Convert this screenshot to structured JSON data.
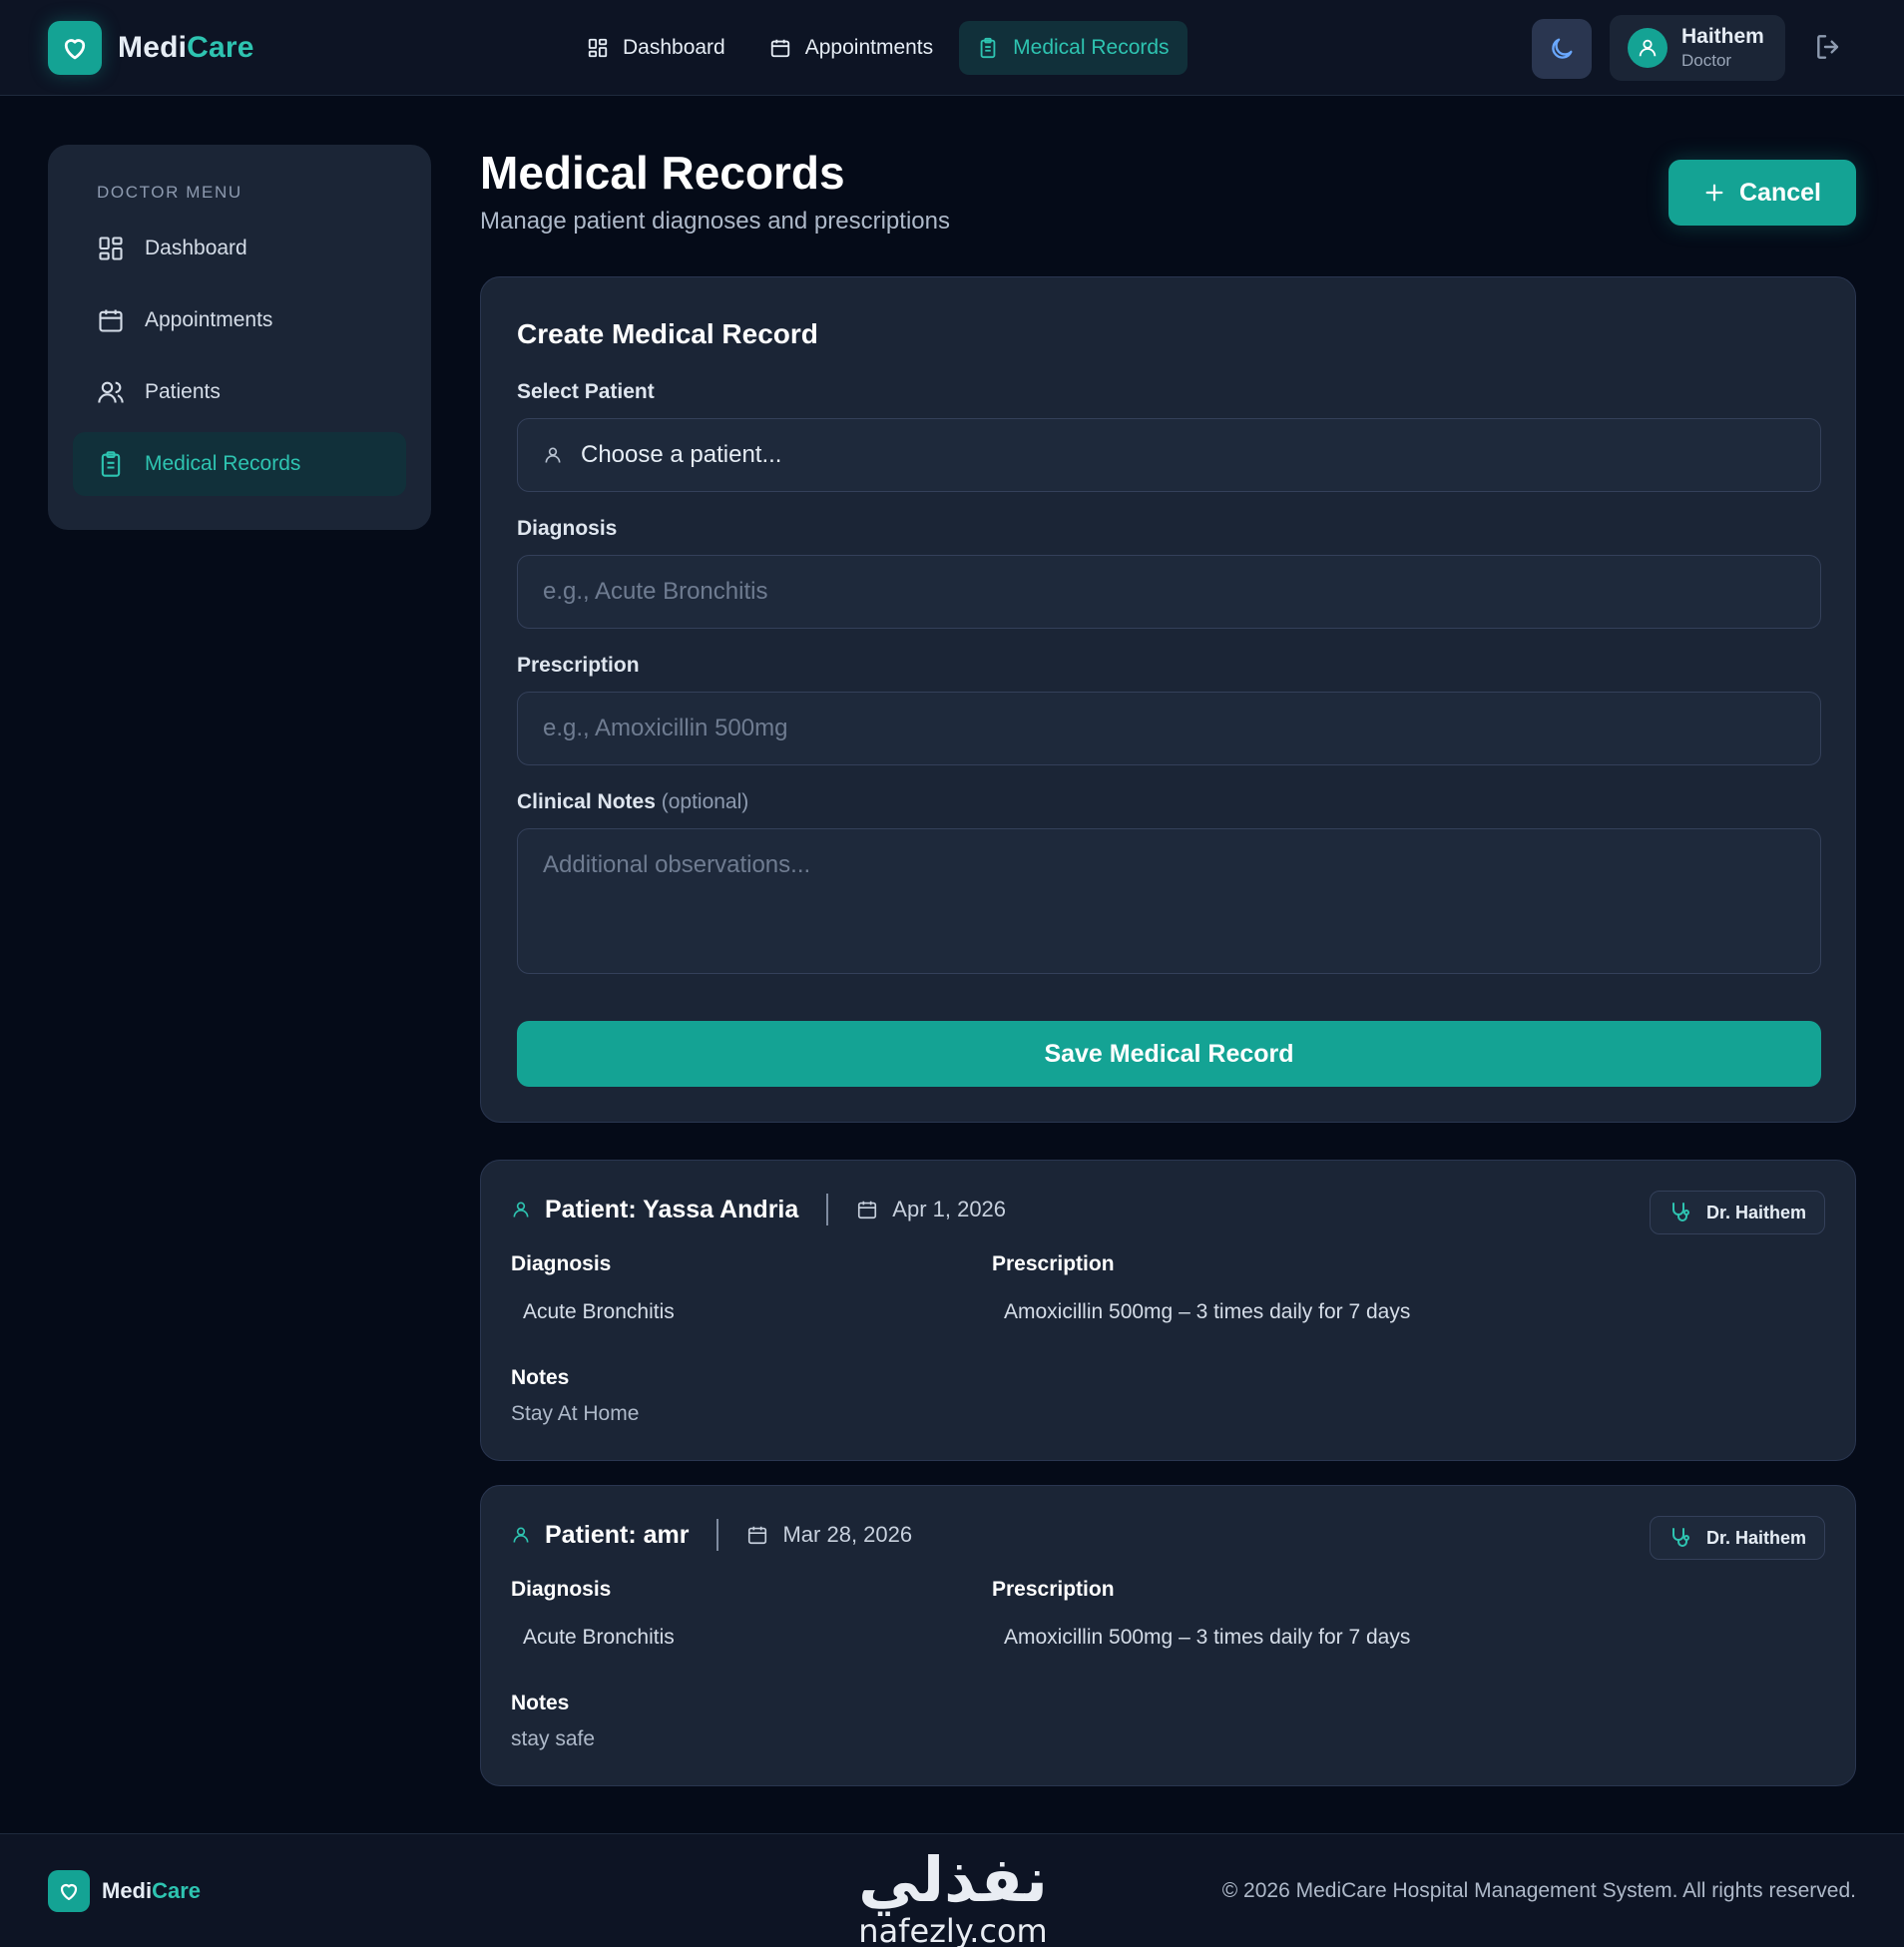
{
  "app": {
    "name_part1": "Medi",
    "name_part2": "Care"
  },
  "nav": [
    {
      "label": "Dashboard",
      "icon": "grid-icon"
    },
    {
      "label": "Appointments",
      "icon": "calendar-icon"
    },
    {
      "label": "Medical Records",
      "icon": "clipboard-icon",
      "active": true
    }
  ],
  "user": {
    "name": "Haithem",
    "role": "Doctor"
  },
  "sidebar": {
    "title": "DOCTOR MENU",
    "items": [
      {
        "label": "Dashboard",
        "icon": "grid-icon"
      },
      {
        "label": "Appointments",
        "icon": "calendar-icon"
      },
      {
        "label": "Patients",
        "icon": "users-icon"
      },
      {
        "label": "Medical Records",
        "icon": "clipboard-icon",
        "active": true
      }
    ]
  },
  "page": {
    "title": "Medical Records",
    "subtitle": "Manage patient diagnoses and prescriptions",
    "cancel_label": "Cancel"
  },
  "form": {
    "title": "Create Medical Record",
    "patient_label": "Select Patient",
    "patient_value": "Choose a patient...",
    "diagnosis_label": "Diagnosis",
    "diagnosis_placeholder": "e.g., Acute Bronchitis",
    "prescription_label": "Prescription",
    "prescription_placeholder": "e.g., Amoxicillin 500mg",
    "notes_label": "Clinical Notes",
    "notes_optional": "(optional)",
    "notes_placeholder": "Additional observations...",
    "save_label": "Save Medical Record"
  },
  "records": [
    {
      "patient": "Patient: Yassa Andria",
      "date": "Apr 1, 2026",
      "doctor": "Dr. Haithem",
      "diagnosis_label": "Diagnosis",
      "diagnosis": "Acute Bronchitis",
      "prescription_label": "Prescription",
      "prescription": "Amoxicillin 500mg – 3 times daily for 7 days",
      "notes_label": "Notes",
      "notes": "Stay At Home"
    },
    {
      "patient": "Patient: amr",
      "date": "Mar 28, 2026",
      "doctor": "Dr. Haithem",
      "diagnosis_label": "Diagnosis",
      "diagnosis": "Acute Bronchitis",
      "prescription_label": "Prescription",
      "prescription": "Amoxicillin 500mg – 3 times daily for 7 days",
      "notes_label": "Notes",
      "notes": "stay safe"
    }
  ],
  "footer": {
    "copyright": "© 2026 MediCare Hospital Management System. All rights reserved.",
    "watermark_ar": "نفذلي",
    "watermark_en": "nafezly.com"
  },
  "colors": {
    "accent": "#14a394",
    "accent_text": "#2ec4b1",
    "background": "#050b18",
    "card": "#1b2536"
  }
}
